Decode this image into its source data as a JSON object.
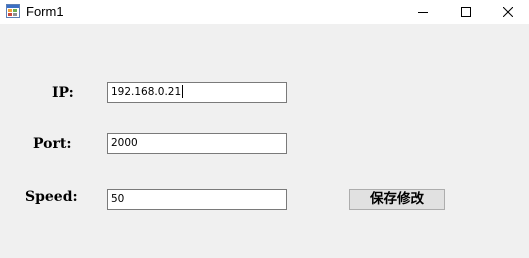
{
  "window": {
    "title": "Form1",
    "icon": "winforms-app-icon",
    "controls": {
      "minimize_icon": "minimize-icon",
      "maximize_icon": "maximize-icon",
      "close_icon": "close-icon"
    }
  },
  "form": {
    "ip": {
      "label": "IP:",
      "value": "192.168.0.21"
    },
    "port": {
      "label": "Port:",
      "value": "2000"
    },
    "speed": {
      "label": "Speed:",
      "value": "50"
    },
    "save_button": "保存修改"
  },
  "colors": {
    "form_background": "#f0f0f0",
    "titlebar_background": "#ffffff",
    "field_border": "#7a7a7a",
    "button_face": "#e1e1e1"
  }
}
